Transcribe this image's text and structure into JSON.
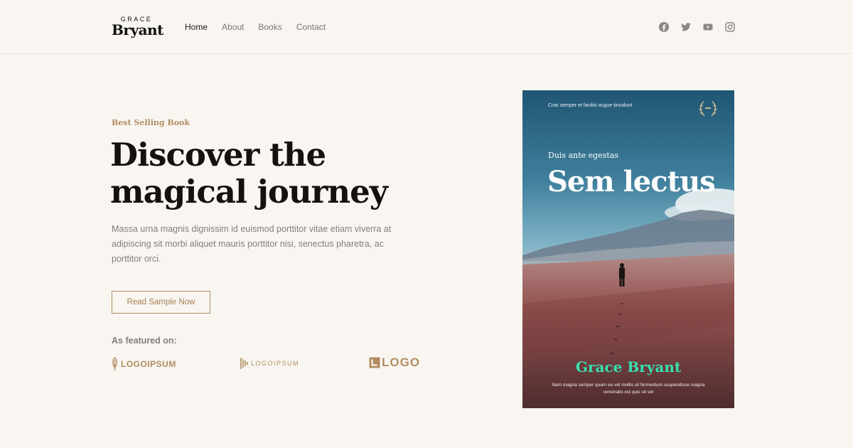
{
  "brand": {
    "top": "GRACE",
    "bottom": "Bryant"
  },
  "nav": {
    "items": [
      "Home",
      "About",
      "Books",
      "Contact"
    ],
    "active": "Home"
  },
  "social": {
    "icons": [
      "facebook-icon",
      "twitter-icon",
      "youtube-icon",
      "instagram-icon"
    ]
  },
  "hero": {
    "eyebrow": "Best Selling Book",
    "headline": "Discover the magical journey",
    "description": "Massa urna magnis dignissim id euismod porttitor vitae etiam viverra at adipiscing sit morbi aliquet mauris porttitor nisi, senectus pharetra, ac porttitor orci.",
    "cta": "Read Sample Now",
    "featured_label": "As featured on:",
    "logos": [
      "LOGOIPSUM",
      "LOGOIPSUM",
      "LOGO"
    ]
  },
  "book": {
    "tagline": "Cras semper et facilisi augue tincidunt",
    "subtitle": "Duis ante egestas",
    "title": "Sem lectus",
    "author": "Grace Bryant",
    "blurb": "Nam magna semper quam eu vel mollis sit fermentum suspendisse magna venenatis est quis sit vel"
  },
  "colors": {
    "background": "#f9f6f1",
    "accent": "#b08d62",
    "heading": "#14110f",
    "body_text": "#857e78",
    "book_author": "#37e0b0"
  }
}
